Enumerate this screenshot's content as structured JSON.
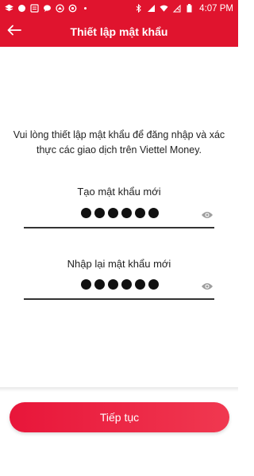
{
  "status_bar": {
    "time": "4:07 PM",
    "icons": [
      "layers-icon",
      "circle-icon",
      "news-icon",
      "chat-icon",
      "cloud-icon",
      "circle-outline-icon",
      "more-dots-icon",
      "bluetooth-icon",
      "signal-icon",
      "wifi-icon",
      "no-sim-icon",
      "battery-icon"
    ]
  },
  "header": {
    "title": "Thiết lập mật khẩu",
    "back_icon": "arrow-left-icon"
  },
  "instruction": "Vui lòng thiết lập mật khẩu để đăng nhập và xác thực các giao dịch trên Viettel Money.",
  "fields": [
    {
      "label": "Tạo mật khẩu mới",
      "masked_length": 6,
      "eye_icon": "eye-icon"
    },
    {
      "label": "Nhập lại mật khẩu mới",
      "masked_length": 6,
      "eye_icon": "eye-icon"
    }
  ],
  "continue_button": "Tiếp tục",
  "colors": {
    "brand": "#e0142e",
    "button": "#e8163a",
    "text": "#222222"
  }
}
